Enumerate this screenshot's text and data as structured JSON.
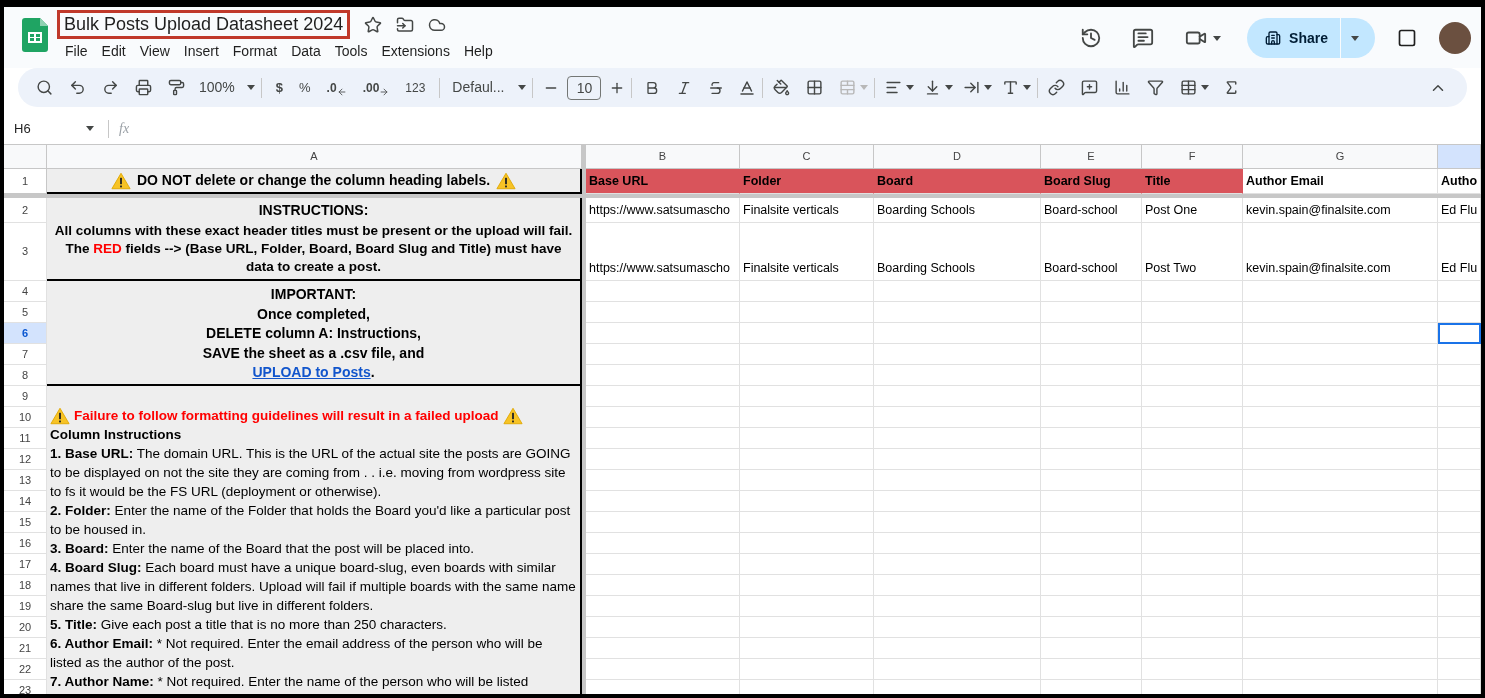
{
  "document": {
    "title": "Bulk Posts Upload Datasheet 2024",
    "menu": [
      "File",
      "Edit",
      "View",
      "Insert",
      "Format",
      "Data",
      "Tools",
      "Extensions",
      "Help"
    ]
  },
  "share_button": {
    "label": "Share"
  },
  "toolbar": {
    "zoom": "100%",
    "currency": "$",
    "percent": "%",
    "decimal_decrease": ".0",
    "decimal_increase": ".00",
    "number_format": "123",
    "font": "Defaul...",
    "font_size": "10",
    "merge_cells": {
      "disabled": true
    }
  },
  "formula_bar": {
    "cell_ref": "H6",
    "fx": "fx"
  },
  "grid": {
    "columns": [
      {
        "label": "A",
        "selected": false
      },
      {
        "label": "B",
        "selected": false
      },
      {
        "label": "C",
        "selected": false
      },
      {
        "label": "D",
        "selected": false
      },
      {
        "label": "E",
        "selected": false
      },
      {
        "label": "F",
        "selected": false
      },
      {
        "label": "G",
        "selected": false
      },
      {
        "selected": true
      }
    ],
    "rows": [
      {
        "label": "1",
        "selected": false
      },
      {
        "label": "2",
        "selected": false
      },
      {
        "label": "3",
        "selected": false
      },
      {
        "label": "4",
        "selected": false
      },
      {
        "label": "5",
        "selected": false
      },
      {
        "label": "6",
        "selected": true
      },
      {
        "label": "7",
        "selected": false
      },
      {
        "label": "8",
        "selected": false
      },
      {
        "label": "9",
        "selected": false
      },
      {
        "label": "10",
        "selected": false
      },
      {
        "label": "11",
        "selected": false
      },
      {
        "label": "12",
        "selected": false
      },
      {
        "label": "13",
        "selected": false
      },
      {
        "label": "14",
        "selected": false
      },
      {
        "label": "15",
        "selected": false
      },
      {
        "label": "16",
        "selected": false
      },
      {
        "label": "17",
        "selected": false
      },
      {
        "label": "18",
        "selected": false
      },
      {
        "label": "19",
        "selected": false
      },
      {
        "label": "20",
        "selected": false
      },
      {
        "label": "21",
        "selected": false
      },
      {
        "label": "22",
        "selected": false
      },
      {
        "label": "23",
        "selected": false
      }
    ]
  },
  "notice": "DO NOT delete or change the column heading labels.",
  "instructions": {
    "heading": "INSTRUCTIONS:",
    "text": "All columns with these exact header titles must be present or the upload will fail.",
    "parts": [
      {
        "text": "The ",
        "highlight": false
      },
      {
        "text": "RED",
        "highlight": true
      },
      {
        "text": " fields --> (Base URL, Folder, Board, Board Slug and Title) must have data to create a post.",
        "highlight": false
      }
    ]
  },
  "important": {
    "heading": "IMPORTANT:",
    "lines": [
      "Once completed,",
      "DELETE column A: Instructions,",
      "SAVE the sheet as a .csv file, and"
    ],
    "link": "UPLOAD to Posts",
    "link_suffix": "."
  },
  "guidelines": {
    "warning": "Failure to follow formatting guidelines will result in a failed upload",
    "heading": "Column Instructions",
    "items": [
      "**1. Base URL:** The domain URL. This is the URL of the actual site the posts are GOING to be displayed on not the site they are coming from . . i.e. moving from wordpress site to fs it would be the FS URL (deployment or otherwise).",
      "**2. Folder:** Enter the name of the Folder that holds the Board you'd like a particular post to be housed in.",
      "**3. Board:** Enter the name of the Board that the post will be placed into.",
      "**4. Board Slug:** Each board must have a unique board-slug, even boards with similar names that live in different folders. Upload will fail if multiple boards with the same name share the same Board-slug but live in different folders.",
      "**5. Title:** Give each post a title that is no more than 250 characters.",
      "**6. Author Email:** * Not required. Enter the email address of the person who will be listed as the author of the post.",
      "**7. Author Name:** * Not required. Enter the name of the person who will be listed"
    ]
  },
  "table": {
    "headers": [
      {
        "text": "Base URL",
        "required": true
      },
      {
        "text": "Folder",
        "required": true
      },
      {
        "text": "Board",
        "required": true
      },
      {
        "text": "Board Slug",
        "required": true
      },
      {
        "text": "Title",
        "required": true
      },
      {
        "text": "Author Email",
        "required": false
      },
      {
        "text": "Autho",
        "required": false
      }
    ],
    "rows": [
      {
        "cells": [
          "https://www.satsumascho",
          "Finalsite verticals",
          "Boarding Schools",
          "Board-school",
          "Post One",
          "kevin.spain@finalsite.com",
          "Ed Flu"
        ]
      },
      {
        "cells": [
          "https://www.satsumascho",
          "Finalsite verticals",
          "Boarding Schools",
          "Board-school",
          "Post Two",
          "kevin.spain@finalsite.com",
          "Ed Flu"
        ]
      }
    ]
  }
}
